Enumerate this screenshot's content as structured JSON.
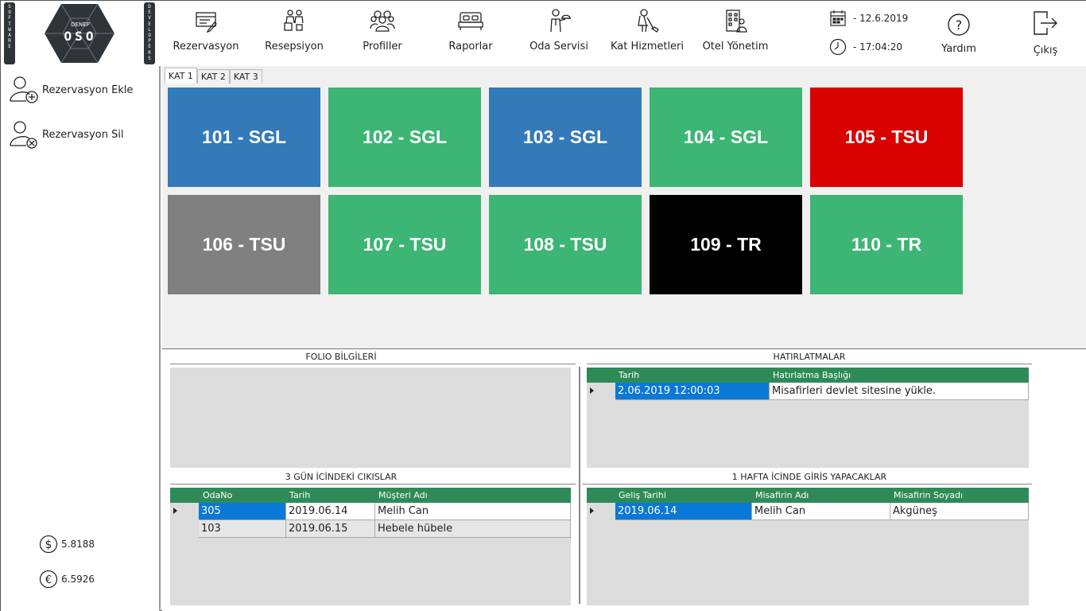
{
  "brand": {
    "left_strip": [
      "S",
      "O",
      "F",
      "T",
      "W",
      "A",
      "R",
      "E"
    ],
    "right_strip": [
      "D",
      "E",
      "V",
      "E",
      "L",
      "O",
      "P",
      "E",
      "R",
      "S"
    ],
    "logo_top": "DENEP",
    "logo_main": "OSO"
  },
  "nav": [
    {
      "label": "Rezervasyon",
      "icon": "reservation-form-icon"
    },
    {
      "label": "Resepsiyon",
      "icon": "reception-icon"
    },
    {
      "label": "Profiller",
      "icon": "profiles-icon"
    },
    {
      "label": "Raporlar",
      "icon": "bed-icon"
    },
    {
      "label": "Oda Servisi",
      "icon": "room-service-icon"
    },
    {
      "label": "Kat Hizmetleri",
      "icon": "housekeeping-icon"
    },
    {
      "label": "Otel Yönetim",
      "icon": "hotel-management-icon"
    }
  ],
  "datetime": {
    "date": "- 12.6.2019",
    "time": "- 17:04:20"
  },
  "help": {
    "label": "Yardım"
  },
  "exit": {
    "label": "Çıkış"
  },
  "left_menu": {
    "add_reservation": "Rezervasyon Ekle",
    "delete_reservation": "Rezervasyon Sil"
  },
  "currency": {
    "usd": "5.8188",
    "eur": "6.5926"
  },
  "tabs": [
    "KAT 1",
    "KAT 2",
    "KAT 3"
  ],
  "active_tab": "KAT 1",
  "colors": {
    "blue": "#3479b8",
    "green": "#3db574",
    "red": "#d90000",
    "gray": "#808080",
    "black": "#000000",
    "header_green": "#2e8b57",
    "selection": "#0a78d7"
  },
  "rooms": [
    {
      "label": "101 - SGL",
      "status": "blue"
    },
    {
      "label": "102 - SGL",
      "status": "green"
    },
    {
      "label": "103 - SGL",
      "status": "blue"
    },
    {
      "label": "104 - SGL",
      "status": "green"
    },
    {
      "label": "105 - TSU",
      "status": "red"
    },
    {
      "label": "106 - TSU",
      "status": "gray"
    },
    {
      "label": "107 - TSU",
      "status": "green"
    },
    {
      "label": "108 - TSU",
      "status": "green"
    },
    {
      "label": "109 - TR",
      "status": "black"
    },
    {
      "label": "110 - TR",
      "status": "green"
    }
  ],
  "sections": {
    "folio": "FOLIO BİLGİLERİ",
    "reminders": "HATIRLATMALAR",
    "checkouts": "3 GÜN İCİNDEKİ CIKISLAR",
    "checkins": "1 HAFTA İCİNDE GİRİS YAPACAKLAR"
  },
  "reminders": {
    "headers": [
      "Tarih",
      "Hatırlatma Başlığı"
    ],
    "rows": [
      [
        "2.06.2019 12:00:03",
        "Misafirleri devlet sitesine yükle."
      ]
    ]
  },
  "checkouts": {
    "headers": [
      "OdaNo",
      "Tarih",
      "Müşteri Adı"
    ],
    "rows": [
      [
        "305",
        "2019.06.14",
        "Melih Can"
      ],
      [
        "103",
        "2019.06.15",
        "Hebele hübele"
      ]
    ]
  },
  "checkins": {
    "headers": [
      "Geliş Tarihi",
      "Misafirin Adı",
      "Misafirin Soyadı"
    ],
    "rows": [
      [
        "2019.06.14",
        "Melih Can",
        "Akgüneş"
      ]
    ]
  }
}
